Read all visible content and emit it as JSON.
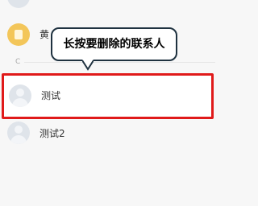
{
  "tooltip": {
    "text": "长按要删除的联系人"
  },
  "divider": {
    "letter": "C"
  },
  "contacts": [
    {
      "name": "黄",
      "avatar": "yellow-avatar-icon"
    },
    {
      "name": "测试",
      "avatar": "default-user-icon",
      "highlighted": true
    },
    {
      "name": "测试2",
      "avatar": "default-user-icon"
    }
  ],
  "colors": {
    "highlight_border": "#e01a1a",
    "tooltip_border": "#1f3240",
    "avatar_yellow": "#f3c65a",
    "avatar_default": "#dfe4ea",
    "background": "#f7f7f7"
  }
}
